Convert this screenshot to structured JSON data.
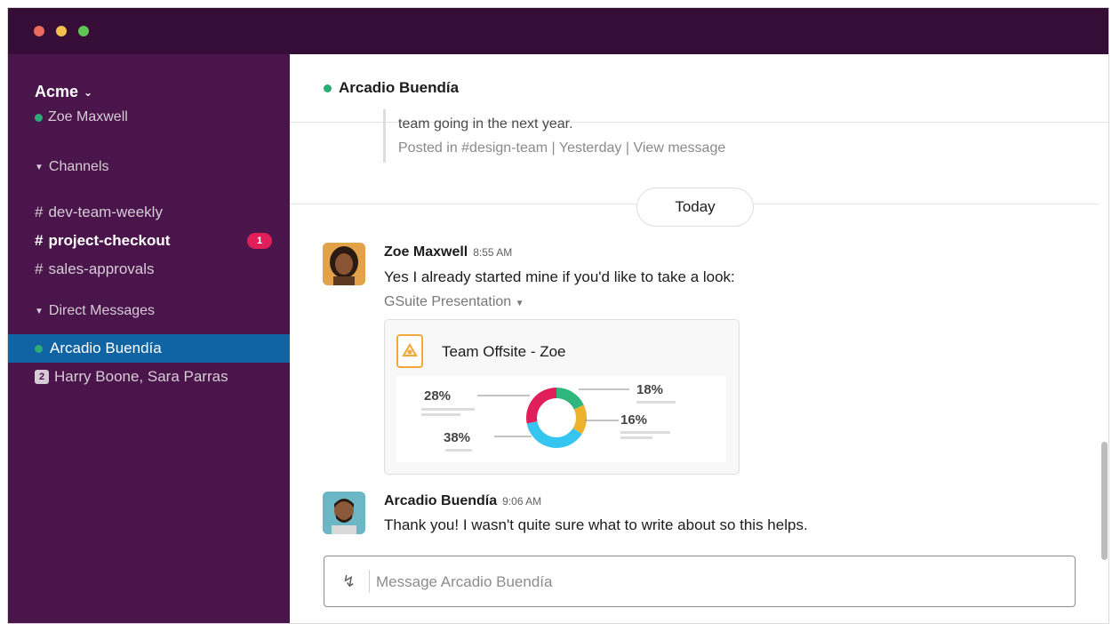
{
  "sidebar": {
    "workspace": "Acme",
    "user": "Zoe Maxwell",
    "channels_header": "Channels",
    "channels": [
      {
        "name": "dev-team-weekly"
      },
      {
        "name": "project-checkout",
        "badge": "1"
      },
      {
        "name": "sales-approvals"
      }
    ],
    "dms_header": "Direct Messages",
    "dms": [
      {
        "name": "Arcadio Buendía"
      },
      {
        "name": "Harry Boone, Sara Parras",
        "count": "2"
      }
    ]
  },
  "header": {
    "title": "Arcadio Buendía"
  },
  "previous": {
    "text": "team going in the next year.",
    "meta_prefix": "Posted in #design-team | Yesterday | ",
    "meta_link": "View message"
  },
  "divider": {
    "label": "Today"
  },
  "messages": [
    {
      "name": "Zoe Maxwell",
      "time": "8:55 AM",
      "text": "Yes I already started mine if you'd like to take a look:",
      "attachment_label": "GSuite Presentation",
      "card_title": "Team Offsite - Zoe"
    },
    {
      "name": "Arcadio Buendía",
      "time": "9:06 AM",
      "text": "Thank you! I wasn't quite sure what to write about so this helps."
    }
  ],
  "chart_data": {
    "type": "pie",
    "categories": [
      "",
      "",
      "",
      ""
    ],
    "values": [
      18,
      16,
      38,
      28
    ],
    "labels": [
      "18%",
      "16%",
      "38%",
      "28%"
    ],
    "colors": [
      "#2eb67d",
      "#ecb22e",
      "#36c5f0",
      "#e01e5a"
    ]
  },
  "composer": {
    "placeholder": "Message Arcadio Buendía"
  },
  "colors": {
    "sidebar": "#4a154b",
    "titlebar": "#350d36",
    "active": "#1164a3",
    "badge": "#e01e5a",
    "presence": "#2bac76"
  }
}
